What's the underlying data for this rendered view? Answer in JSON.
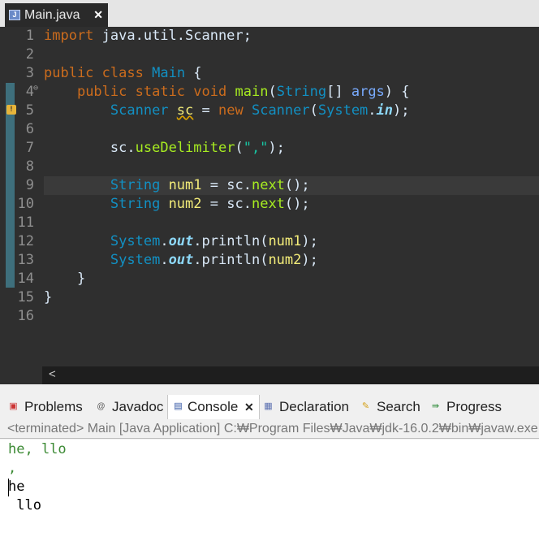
{
  "editor_tab": {
    "title": "Main.java",
    "icon": "java-file-icon",
    "close": "✕"
  },
  "code": {
    "line_numbers": [
      "1",
      "2",
      "3",
      "4",
      "5",
      "6",
      "7",
      "8",
      "9",
      "10",
      "11",
      "12",
      "13",
      "14",
      "15",
      "16"
    ],
    "current_line": 9,
    "tokens": {
      "l1": {
        "kw": "import",
        "rest": " java.util.Scanner;"
      },
      "l3": {
        "kw1": "public",
        "kw2": "class",
        "cls": "Main",
        "rest": " {"
      },
      "l4": {
        "kw1": "public",
        "kw2": "static",
        "kw3": "void",
        "mtd": "main",
        "p1": "(",
        "ty": "String",
        "p2": "[] ",
        "arg": "args",
        "rest": ") {"
      },
      "l5": {
        "ty": "Scanner",
        "var": "sc",
        "eq": " = ",
        "kw": "new",
        "ty2": "Scanner",
        "p1": "(",
        "ty3": "System",
        "dot": ".",
        "fld": "in",
        "rest": ");"
      },
      "l7": {
        "obj": "sc",
        "dot": ".",
        "mtd": "useDelimiter",
        "p1": "(",
        "str": "\",\"",
        "rest": ");"
      },
      "l9": {
        "ty": "String",
        "var": "num1",
        "eq": " = ",
        "obj": "sc",
        "dot": ".",
        "mtd": "next",
        "rest": "();"
      },
      "l10": {
        "ty": "String",
        "var": "num2",
        "eq": " = ",
        "obj": "sc",
        "dot": ".",
        "mtd": "next",
        "rest": "();"
      },
      "l12": {
        "ty": "System",
        "dot": ".",
        "fld": "out",
        "dot2": ".",
        "mtd": "println",
        "p1": "(",
        "var": "num1",
        "rest": ");"
      },
      "l13": {
        "ty": "System",
        "dot": ".",
        "fld": "out",
        "dot2": ".",
        "mtd": "println",
        "p1": "(",
        "var": "num2",
        "rest": ");"
      },
      "l14": "}",
      "l15": "}"
    }
  },
  "scrollbar": {
    "left_arrow": "<"
  },
  "views": {
    "tabs": [
      {
        "label": "Problems",
        "icon": "problems-icon"
      },
      {
        "label": "Javadoc",
        "icon": "javadoc-icon"
      },
      {
        "label": "Console",
        "icon": "console-icon",
        "active": true,
        "close": "✕"
      },
      {
        "label": "Declaration",
        "icon": "declaration-icon"
      },
      {
        "label": "Search",
        "icon": "search-icon"
      },
      {
        "label": "Progress",
        "icon": "progress-icon"
      }
    ]
  },
  "console": {
    "description": "<terminated> Main [Java Application] C:₩Program Files₩Java₩jdk-16.0.2₩bin₩javaw.exe",
    "lines": [
      {
        "text": "he, llo",
        "kind": "input"
      },
      {
        "text": ",",
        "kind": "input"
      },
      {
        "text": "he",
        "kind": "stdout"
      },
      {
        "text": " llo",
        "kind": "stdout"
      }
    ]
  },
  "colors": {
    "editor_bg": "#2f2f2f",
    "keyword": "#cc6c1d",
    "type": "#1290c3",
    "variable": "#f3ec79",
    "string": "#17c6a3",
    "method": "#a7ec21",
    "field": "#8dd8f8",
    "console_input": "#3c8a34"
  }
}
